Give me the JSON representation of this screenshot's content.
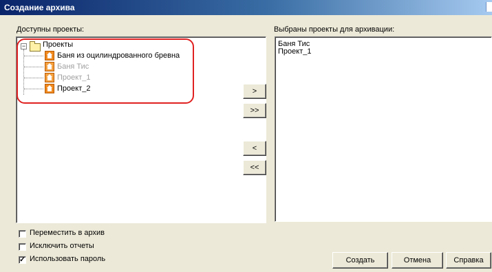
{
  "window": {
    "title": "Создание архива"
  },
  "available": {
    "label": "Доступны проекты:",
    "tree": {
      "root": "Проекты",
      "items": [
        {
          "label": "Баня из оцилиндрованного бревна",
          "enabled": true
        },
        {
          "label": "Баня Тис",
          "enabled": false
        },
        {
          "label": "Проект_1",
          "enabled": false
        },
        {
          "label": "Проект_2",
          "enabled": true
        }
      ]
    }
  },
  "selected": {
    "label": "Выбраны проекты для архивации:",
    "items": [
      "Баня Тис",
      "Проект_1"
    ]
  },
  "transfer_buttons": {
    "add_one": ">",
    "add_all": ">>",
    "remove_one": "<",
    "remove_all": "<<"
  },
  "options": [
    {
      "label": "Переместить в архив",
      "checked": false
    },
    {
      "label": "Исключить отчеты",
      "checked": false
    },
    {
      "label": "Использовать пароль",
      "checked": true
    }
  ],
  "actions": {
    "create": "Создать",
    "cancel": "Отмена",
    "help": "Справка"
  },
  "colors": {
    "titlebar_start": "#0a246a",
    "annotation": "#e02020",
    "dialog_bg": "#ece9d8"
  }
}
